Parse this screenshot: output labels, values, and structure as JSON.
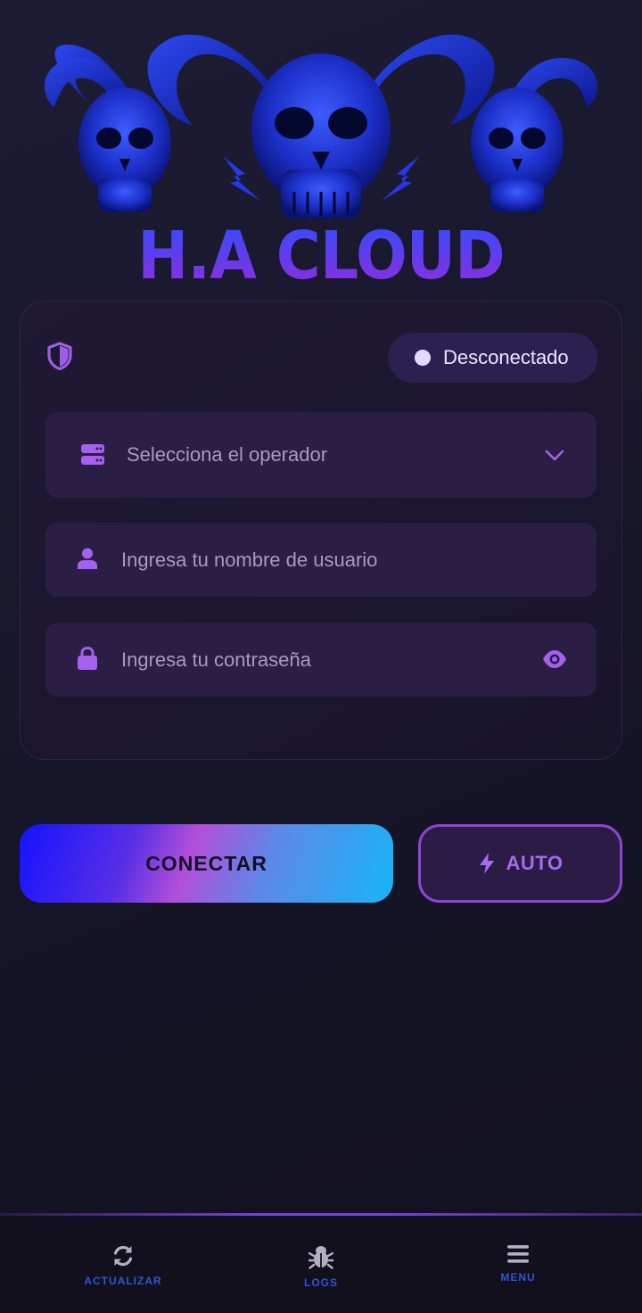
{
  "brand": {
    "title": "H.A CLOUD"
  },
  "status": {
    "text": "Desconectado"
  },
  "form": {
    "operator_placeholder": "Selecciona el operador",
    "username_placeholder": "Ingresa tu nombre de usuario",
    "password_placeholder": "Ingresa tu contraseña"
  },
  "buttons": {
    "connect_label": "CONECTAR",
    "auto_label": "AUTO"
  },
  "bottom_nav": {
    "items": [
      {
        "label": "ACTUALIZAR",
        "icon": "refresh-icon"
      },
      {
        "label": "LOGS",
        "icon": "bug-icon"
      },
      {
        "label": "MENU",
        "icon": "menu-icon"
      }
    ]
  },
  "colors": {
    "accent": "#8d45d6",
    "nav_label": "#2f55d8",
    "connect_gradient_start": "#1313ff",
    "connect_gradient_end": "#16b6f7"
  }
}
